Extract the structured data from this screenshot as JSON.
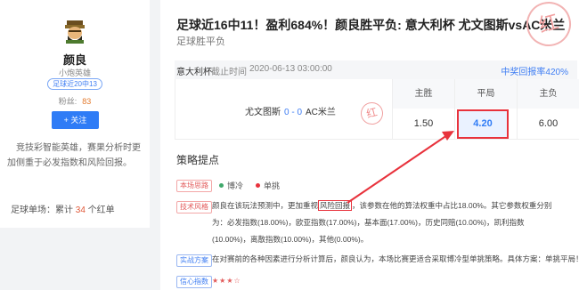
{
  "profile": {
    "name": "颜良",
    "title": "小炮英雄",
    "badge": "足球近20中13",
    "fans_label": "粉丝:",
    "fans_count": "83",
    "follow_label": "+ 关注",
    "description": "竞技彩智能英雄，赛果分析时更加侧重于必发指数和风险回报。",
    "stats_prefix": "足球单场：累计",
    "stats_count": "34",
    "stats_suffix": "个红单"
  },
  "article": {
    "title": "足球近16中11！盈利684%！颜良胜平负: 意大利杯 尤文图斯vsAC米兰",
    "subtitle": "足球胜平负",
    "stamp": "红"
  },
  "match": {
    "league": "意大利杯",
    "deadline_label": "截止时间",
    "deadline": "2020-06-13 03:00:00",
    "return_rate": "中奖回报率420%",
    "home": "尤文图斯",
    "score": "0 - 0",
    "away": "AC米兰"
  },
  "odds": {
    "headers": [
      "主胜",
      "平局",
      "主负"
    ],
    "values": [
      "1.50",
      "4.20",
      "6.00"
    ],
    "selected_index": 1
  },
  "strategy": {
    "section_title": "策略提点",
    "tag_thinking": "本场思路",
    "legend_cold": "博冷",
    "legend_single": "单挑",
    "tag_style": "技术风格",
    "style_text_1": "颜良在该玩法预测中，更加重视",
    "style_highlight": "风险回报",
    "style_text_2": "，该参数在他的算法权重中占比18.00%。其它参数权重分别为：必发指数(18.00%)，欧亚指数(17.00%)，基本面(17.00%)，历史同赔(10.00%)，凯利指数(10.00%)，离散指数(10.00%)，其他(0.00%)。",
    "tag_plan": "实战方案",
    "plan_text": "在对赛前的各种因素进行分析计算后，颜良认为，本场比赛更适合采取博冷型单挑策略。具体方案：单挑平局！",
    "tag_confidence": "信心指数",
    "stars": "★★★☆"
  },
  "colors": {
    "accent": "#2f7cf6",
    "red": "#e8323c",
    "orange": "#e37a2e"
  }
}
